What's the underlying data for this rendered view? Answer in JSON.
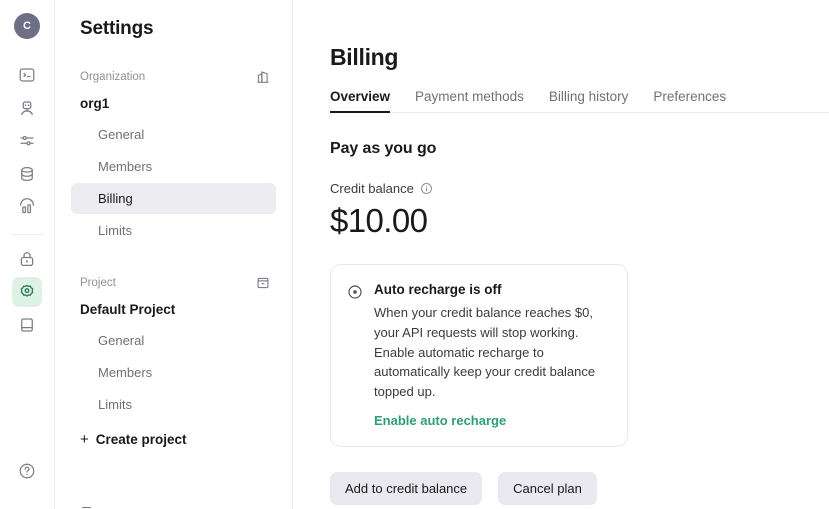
{
  "rail": {
    "avatar": {
      "initial": "C",
      "name": "user-avatar",
      "bg": "#6e6e85"
    },
    "icons": [
      {
        "name": "playground-terminal-icon",
        "glyph": "terminal"
      },
      {
        "name": "assistants-robot-icon",
        "glyph": "robot"
      },
      {
        "name": "fine-tuning-sliders-icon",
        "glyph": "sliders"
      },
      {
        "name": "storage-database-icon",
        "glyph": "database"
      },
      {
        "name": "usage-chart-icon",
        "glyph": "chart"
      }
    ],
    "icons_lower": [
      {
        "name": "api-keys-lock-icon",
        "glyph": "lock",
        "active": false
      },
      {
        "name": "settings-gear-icon",
        "glyph": "gear",
        "active": true
      },
      {
        "name": "docs-book-icon",
        "glyph": "book",
        "active": false
      }
    ],
    "help": {
      "name": "help-icon",
      "glyph": "question"
    },
    "active_color": "#2e7d5b",
    "active_bg": "#ddf2e4"
  },
  "nav": {
    "title": "Settings",
    "organization": {
      "section_label": "Organization",
      "section_icon": "organization-building-icon",
      "name": "org1",
      "items": [
        {
          "label": "General",
          "selected": false
        },
        {
          "label": "Members",
          "selected": false
        },
        {
          "label": "Billing",
          "selected": true
        },
        {
          "label": "Limits",
          "selected": false
        }
      ]
    },
    "project": {
      "section_label": "Project",
      "section_icon": "project-archive-icon",
      "name": "Default Project",
      "items": [
        {
          "label": "General",
          "selected": false
        },
        {
          "label": "Members",
          "selected": false
        },
        {
          "label": "Limits",
          "selected": false
        }
      ]
    },
    "create_project": {
      "label": "Create project",
      "plus": "+"
    }
  },
  "main": {
    "title": "Billing",
    "tabs": [
      {
        "label": "Overview",
        "active": true
      },
      {
        "label": "Payment methods",
        "active": false
      },
      {
        "label": "Billing history",
        "active": false
      },
      {
        "label": "Preferences",
        "active": false
      }
    ],
    "section_heading": "Pay as you go",
    "credit_balance": {
      "label": "Credit balance",
      "info_icon": "info-icon",
      "amount": "$10.00"
    },
    "auto_recharge_card": {
      "status_icon": "auto-recharge-off-icon",
      "title": "Auto recharge is off",
      "body": "When your credit balance reaches $0, your API requests will stop working. Enable automatic recharge to automatically keep your credit balance topped up.",
      "link": "Enable auto recharge",
      "link_color": "#2e9e74"
    },
    "buttons": [
      {
        "label": "Add to credit balance",
        "name": "add-to-credit-balance-button"
      },
      {
        "label": "Cancel plan",
        "name": "cancel-plan-button"
      }
    ]
  }
}
